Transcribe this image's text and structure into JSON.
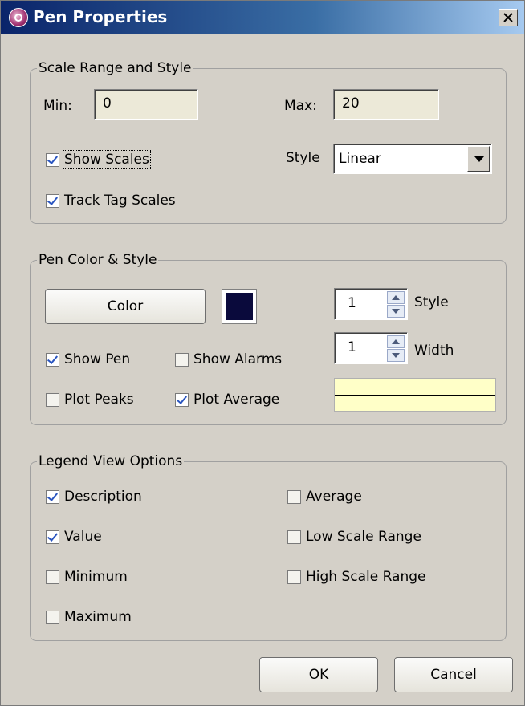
{
  "window": {
    "title": "Pen Properties",
    "title_icon": "app-icon",
    "close_icon": "close-icon"
  },
  "scale_group": {
    "title": "Scale Range and Style",
    "min_label": "Min:",
    "min_value": "0",
    "max_label": "Max:",
    "max_value": "20",
    "show_scales": {
      "label": "Show Scales",
      "checked": true
    },
    "track_tag_scales": {
      "label": "Track Tag Scales",
      "checked": true
    },
    "style_label": "Style",
    "style_value": "Linear"
  },
  "pen_group": {
    "title": "Pen Color & Style",
    "color_button": "Color",
    "color_swatch": "#0a0a3c",
    "style_value": "1",
    "style_label": "Style",
    "width_value": "1",
    "width_label": "Width",
    "show_pen": {
      "label": "Show Pen",
      "checked": true
    },
    "show_alarms": {
      "label": "Show Alarms",
      "checked": false
    },
    "plot_peaks": {
      "label": "Plot Peaks",
      "checked": false
    },
    "plot_average": {
      "label": "Plot Average",
      "checked": true
    },
    "preview_bg": "#ffffc8"
  },
  "legend_group": {
    "title": "Legend View Options",
    "description": {
      "label": "Description",
      "checked": true
    },
    "value": {
      "label": "Value",
      "checked": true
    },
    "minimum": {
      "label": "Minimum",
      "checked": false
    },
    "maximum": {
      "label": "Maximum",
      "checked": false
    },
    "average": {
      "label": "Average",
      "checked": false
    },
    "low_scale_range": {
      "label": "Low Scale Range",
      "checked": false
    },
    "high_scale_range": {
      "label": "High Scale Range",
      "checked": false
    }
  },
  "buttons": {
    "ok": "OK",
    "cancel": "Cancel"
  }
}
